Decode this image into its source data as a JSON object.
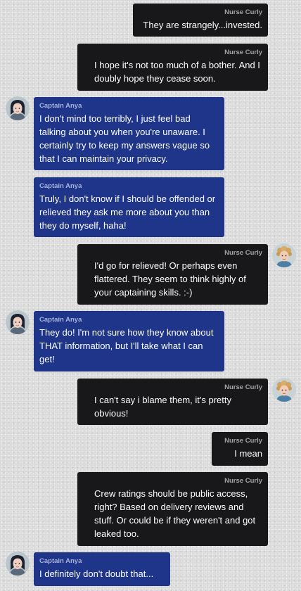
{
  "chat": {
    "messages": [
      {
        "sender": "Nurse Curly",
        "text": "They are strangely...invested."
      },
      {
        "sender": "Nurse Curly",
        "text": "I hope it's not too much of a bother. And I doubly hope they cease soon."
      },
      {
        "sender": "Captain Anya",
        "text": "I don't mind too terribly, I just feel bad talking about you when you're unaware. I certainly try to keep my answers vague so that I can maintain your privacy."
      },
      {
        "sender": "Captain Anya",
        "text": "Truly, I don't know if I should be offended or relieved they ask me more about you than they do myself, haha!"
      },
      {
        "sender": "Nurse Curly",
        "text": "I'd go for relieved! Or perhaps even flattered. They seem to think highly of your captaining skills. :-)"
      },
      {
        "sender": "Captain Anya",
        "text": "They do! I'm not sure how they know about THAT information, but I'll take what I can get!"
      },
      {
        "sender": "Nurse Curly",
        "text": "I can't say i blame them, it's pretty obvious!"
      },
      {
        "sender": "Nurse Curly",
        "text": "I mean"
      },
      {
        "sender": "Nurse Curly",
        "text": "Crew ratings should be public access, right? Based on delivery reviews and stuff. Or could be if they weren't and got leaked too."
      },
      {
        "sender": "Captain Anya",
        "text": "I definitely don't doubt that..."
      }
    ]
  },
  "colors": {
    "sent_bubble": "#18181b",
    "received_bubble": "#1f3589",
    "background": "#d9d9d9"
  },
  "avatars": {
    "captain_anya": "dark-haired-woman-avatar",
    "nurse_curly": "blonde-curly-haired-man-avatar"
  }
}
